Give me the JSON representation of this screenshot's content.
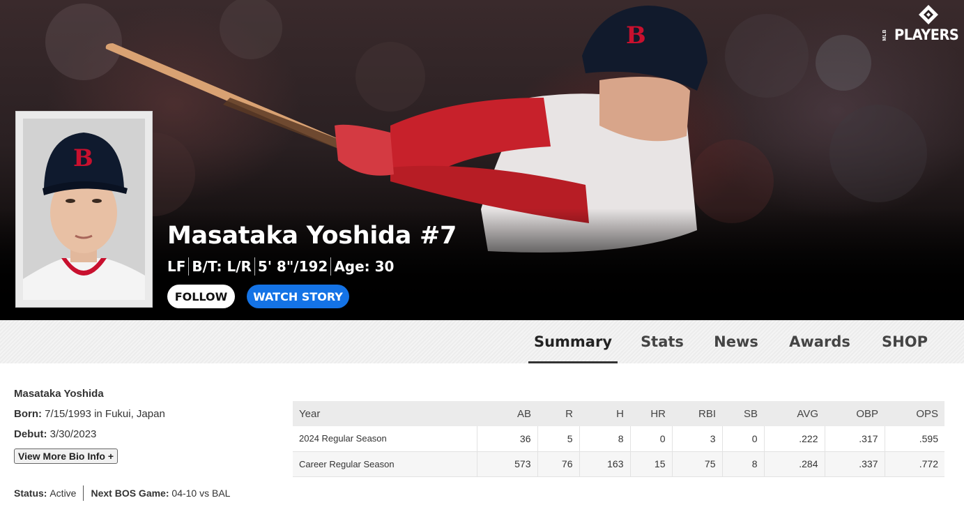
{
  "brand": {
    "prefix": "MLB",
    "name": "PLAYERS"
  },
  "player": {
    "name_title": "Masataka Yoshida #7",
    "vitals": [
      "LF",
      "B/T: L/R",
      "5' 8\"/192",
      "Age: 30"
    ],
    "cap_letter": "B"
  },
  "actions": {
    "follow_label": "FOLLOW",
    "watch_label": "WATCH STORY"
  },
  "tabs": [
    {
      "label": "Summary",
      "active": true
    },
    {
      "label": "Stats",
      "active": false
    },
    {
      "label": "News",
      "active": false
    },
    {
      "label": "Awards",
      "active": false
    },
    {
      "label": "SHOP",
      "active": false
    }
  ],
  "bio": {
    "name": "Masataka Yoshida",
    "born_label": "Born:",
    "born_value": "7/15/1993 in Fukui, Japan",
    "debut_label": "Debut:",
    "debut_value": "3/30/2023",
    "more_label": "View More Bio Info +",
    "status_label": "Status:",
    "status_value": "Active",
    "next_game_label": "Next BOS Game:",
    "next_game_value": "04-10 vs BAL"
  },
  "stats": {
    "columns": [
      "Year",
      "AB",
      "R",
      "H",
      "HR",
      "RBI",
      "SB",
      "AVG",
      "OBP",
      "OPS"
    ],
    "rows": [
      [
        "2024 Regular Season",
        "36",
        "5",
        "8",
        "0",
        "3",
        "0",
        ".222",
        ".317",
        ".595"
      ],
      [
        "Career Regular Season",
        "573",
        "76",
        "163",
        "15",
        "75",
        "8",
        ".284",
        ".337",
        ".772"
      ]
    ]
  },
  "colors": {
    "accent_blue": "#1473e6",
    "sox_red": "#c8102e",
    "navy": "#0c2340"
  }
}
